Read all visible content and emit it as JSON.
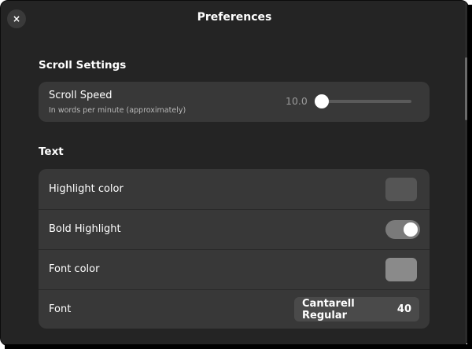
{
  "window": {
    "title": "Preferences",
    "close_icon": "close-icon",
    "close_glyph": "×"
  },
  "scroll_settings": {
    "section_title": "Scroll Settings",
    "scroll_speed_label": "Scroll Speed",
    "scroll_speed_sublabel": "In words per minute (approximately)",
    "scroll_speed_value": "10.0"
  },
  "text": {
    "section_title": "Text",
    "highlight_color_label": "Highlight color",
    "highlight_color_swatch": "#555555",
    "bold_highlight_label": "Bold Highlight",
    "bold_highlight_on": true,
    "font_color_label": "Font color",
    "font_color_swatch": "#8a8a8a",
    "font_label": "Font",
    "font_name": "Cantarell Regular",
    "font_size": "40"
  }
}
